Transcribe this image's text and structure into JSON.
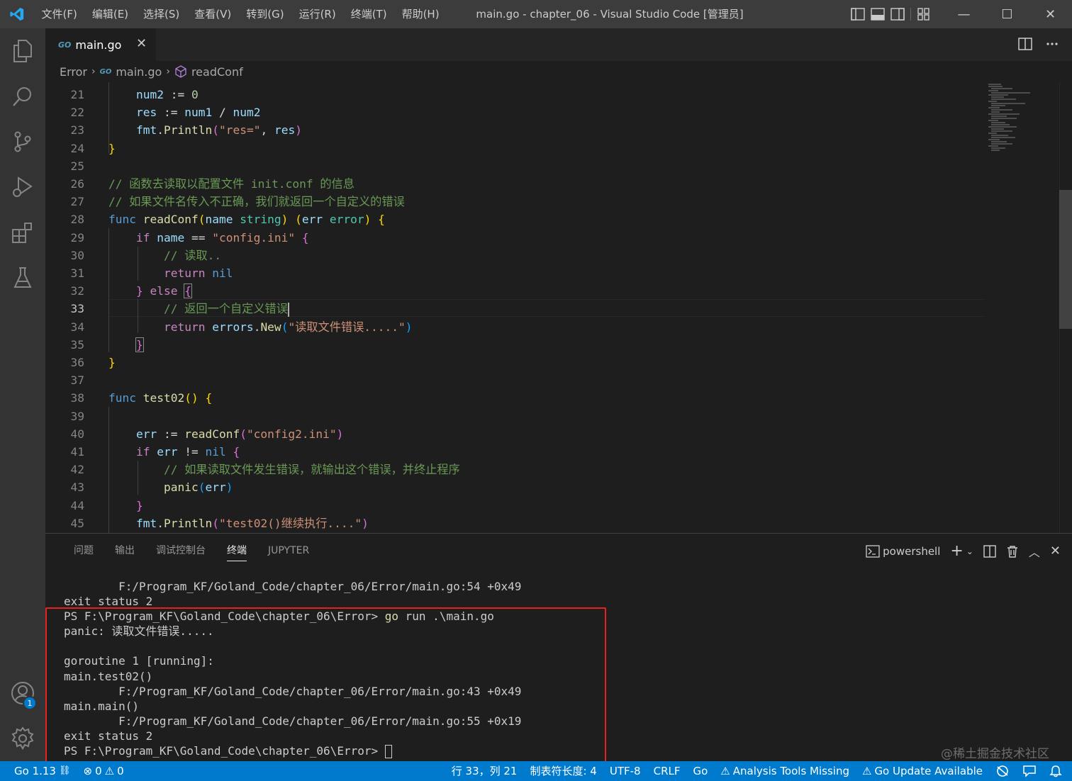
{
  "titlebar": {
    "menus": [
      "文件(F)",
      "编辑(E)",
      "选择(S)",
      "查看(V)",
      "转到(G)",
      "运行(R)",
      "终端(T)",
      "帮助(H)"
    ],
    "title": "main.go - chapter_06 - Visual Studio Code [管理员]"
  },
  "tab": {
    "icon_text": "GO",
    "label": "main.go",
    "close": "✕"
  },
  "breadcrumb": {
    "folder": "Error",
    "icon_text": "GO",
    "file": "main.go",
    "symbol": "readConf"
  },
  "editor": {
    "current_line": "33",
    "lines": [
      {
        "n": "21",
        "html": "    <span class=\"var\">num2</span> := <span class=\"num\">0</span>"
      },
      {
        "n": "22",
        "html": "    <span class=\"var\">res</span> := <span class=\"var\">num1</span> / <span class=\"var\">num2</span>"
      },
      {
        "n": "23",
        "html": "    <span class=\"var\">fmt</span>.<span class=\"fn\">Println</span><span class=\"br2\">(</span><span class=\"str\">\"res=\"</span>, <span class=\"var\">res</span><span class=\"br2\">)</span>"
      },
      {
        "n": "24",
        "html": "<span class=\"br1\">}</span>"
      },
      {
        "n": "25",
        "html": ""
      },
      {
        "n": "26",
        "html": "<span class=\"cmt\">// 函数去读取以配置文件 init.conf 的信息</span>"
      },
      {
        "n": "27",
        "html": "<span class=\"cmt\">// 如果文件名传入不正确，我们就返回一个自定义的错误</span>"
      },
      {
        "n": "28",
        "html": "<span class=\"kw\">func</span> <span class=\"fn\">readConf</span><span class=\"br1\">(</span><span class=\"var\">name</span> <span class=\"typ\">string</span><span class=\"br1\">)</span> <span class=\"br1\">(</span><span class=\"var\">err</span> <span class=\"typ\">error</span><span class=\"br1\">)</span> <span class=\"br1\">{</span>"
      },
      {
        "n": "29",
        "html": "    <span class=\"ctrl\">if</span> <span class=\"var\">name</span> == <span class=\"str\">\"config.ini\"</span> <span class=\"br2\">{</span>"
      },
      {
        "n": "30",
        "html": "        <span class=\"cmt\">// 读取..</span>"
      },
      {
        "n": "31",
        "html": "        <span class=\"ctrl\">return</span> <span class=\"kw\">nil</span>"
      },
      {
        "n": "32",
        "html": "    <span class=\"br2\">}</span> <span class=\"ctrl\">else</span> <span class=\"br2 bracket-match\">{</span>"
      },
      {
        "n": "33",
        "html": "        <span class=\"cmt\">// 返回一个自定义错误</span><span class=\"cursor\"></span>"
      },
      {
        "n": "34",
        "html": "        <span class=\"ctrl\">return</span> <span class=\"var\">errors</span>.<span class=\"fn\">New</span><span class=\"br3\">(</span><span class=\"str\">\"读取文件错误.....\"</span><span class=\"br3\">)</span>"
      },
      {
        "n": "35",
        "html": "    <span class=\"br2 bracket-match\">}</span>"
      },
      {
        "n": "36",
        "html": "<span class=\"br1\">}</span>"
      },
      {
        "n": "37",
        "html": ""
      },
      {
        "n": "38",
        "html": "<span class=\"kw\">func</span> <span class=\"fn\">test02</span><span class=\"br1\">()</span> <span class=\"br1\">{</span>"
      },
      {
        "n": "39",
        "html": ""
      },
      {
        "n": "40",
        "html": "    <span class=\"var\">err</span> := <span class=\"fn\">readConf</span><span class=\"br2\">(</span><span class=\"str\">\"config2.ini\"</span><span class=\"br2\">)</span>"
      },
      {
        "n": "41",
        "html": "    <span class=\"ctrl\">if</span> <span class=\"var\">err</span> != <span class=\"kw\">nil</span> <span class=\"br2\">{</span>"
      },
      {
        "n": "42",
        "html": "        <span class=\"cmt\">// 如果读取文件发生错误，就输出这个错误，并终止程序</span>"
      },
      {
        "n": "43",
        "html": "        <span class=\"fn\">panic</span><span class=\"br3\">(</span><span class=\"var\">err</span><span class=\"br3\">)</span>"
      },
      {
        "n": "44",
        "html": "    <span class=\"br2\">}</span>"
      },
      {
        "n": "45",
        "html": "    <span class=\"var\">fmt</span>.<span class=\"fn\">Println</span><span class=\"br2\">(</span><span class=\"str\">\"test02()继续执行....\"</span><span class=\"br2\">)</span>"
      }
    ]
  },
  "panel": {
    "tabs": [
      "问题",
      "输出",
      "调试控制台",
      "终端",
      "JUPYTER"
    ],
    "active_tab": "终端",
    "shell": "powershell"
  },
  "terminal": {
    "lines": [
      "        F:/Program_KF/Goland_Code/chapter_06/Error/main.go:54 +0x49",
      "exit status 2",
      "PS F:\\Program_KF\\Goland_Code\\chapter_06\\Error> |go| run .\\main.go",
      "panic: 读取文件错误.....",
      "",
      "goroutine 1 [running]:",
      "main.test02()",
      "        F:/Program_KF/Goland_Code/chapter_06/Error/main.go:43 +0x49",
      "main.main()",
      "        F:/Program_KF/Goland_Code/chapter_06/Error/main.go:55 +0x19",
      "exit status 2",
      "PS F:\\Program_KF\\Goland_Code\\chapter_06\\Error> "
    ]
  },
  "watermark": "@稀土掘金技术社区",
  "accounts_badge": "1",
  "statusbar": {
    "go_version": "Go 1.13",
    "errors": "0",
    "warnings": "0",
    "position": "行 33，列 21",
    "tab_size": "制表符长度: 4",
    "encoding": "UTF-8",
    "eol": "CRLF",
    "language": "Go",
    "analysis": "Analysis Tools Missing",
    "update": "Go Update Available"
  },
  "colors": {
    "accent": "#007acc",
    "titlebar": "#3c3c3c",
    "highlight_box": "#e62121"
  }
}
